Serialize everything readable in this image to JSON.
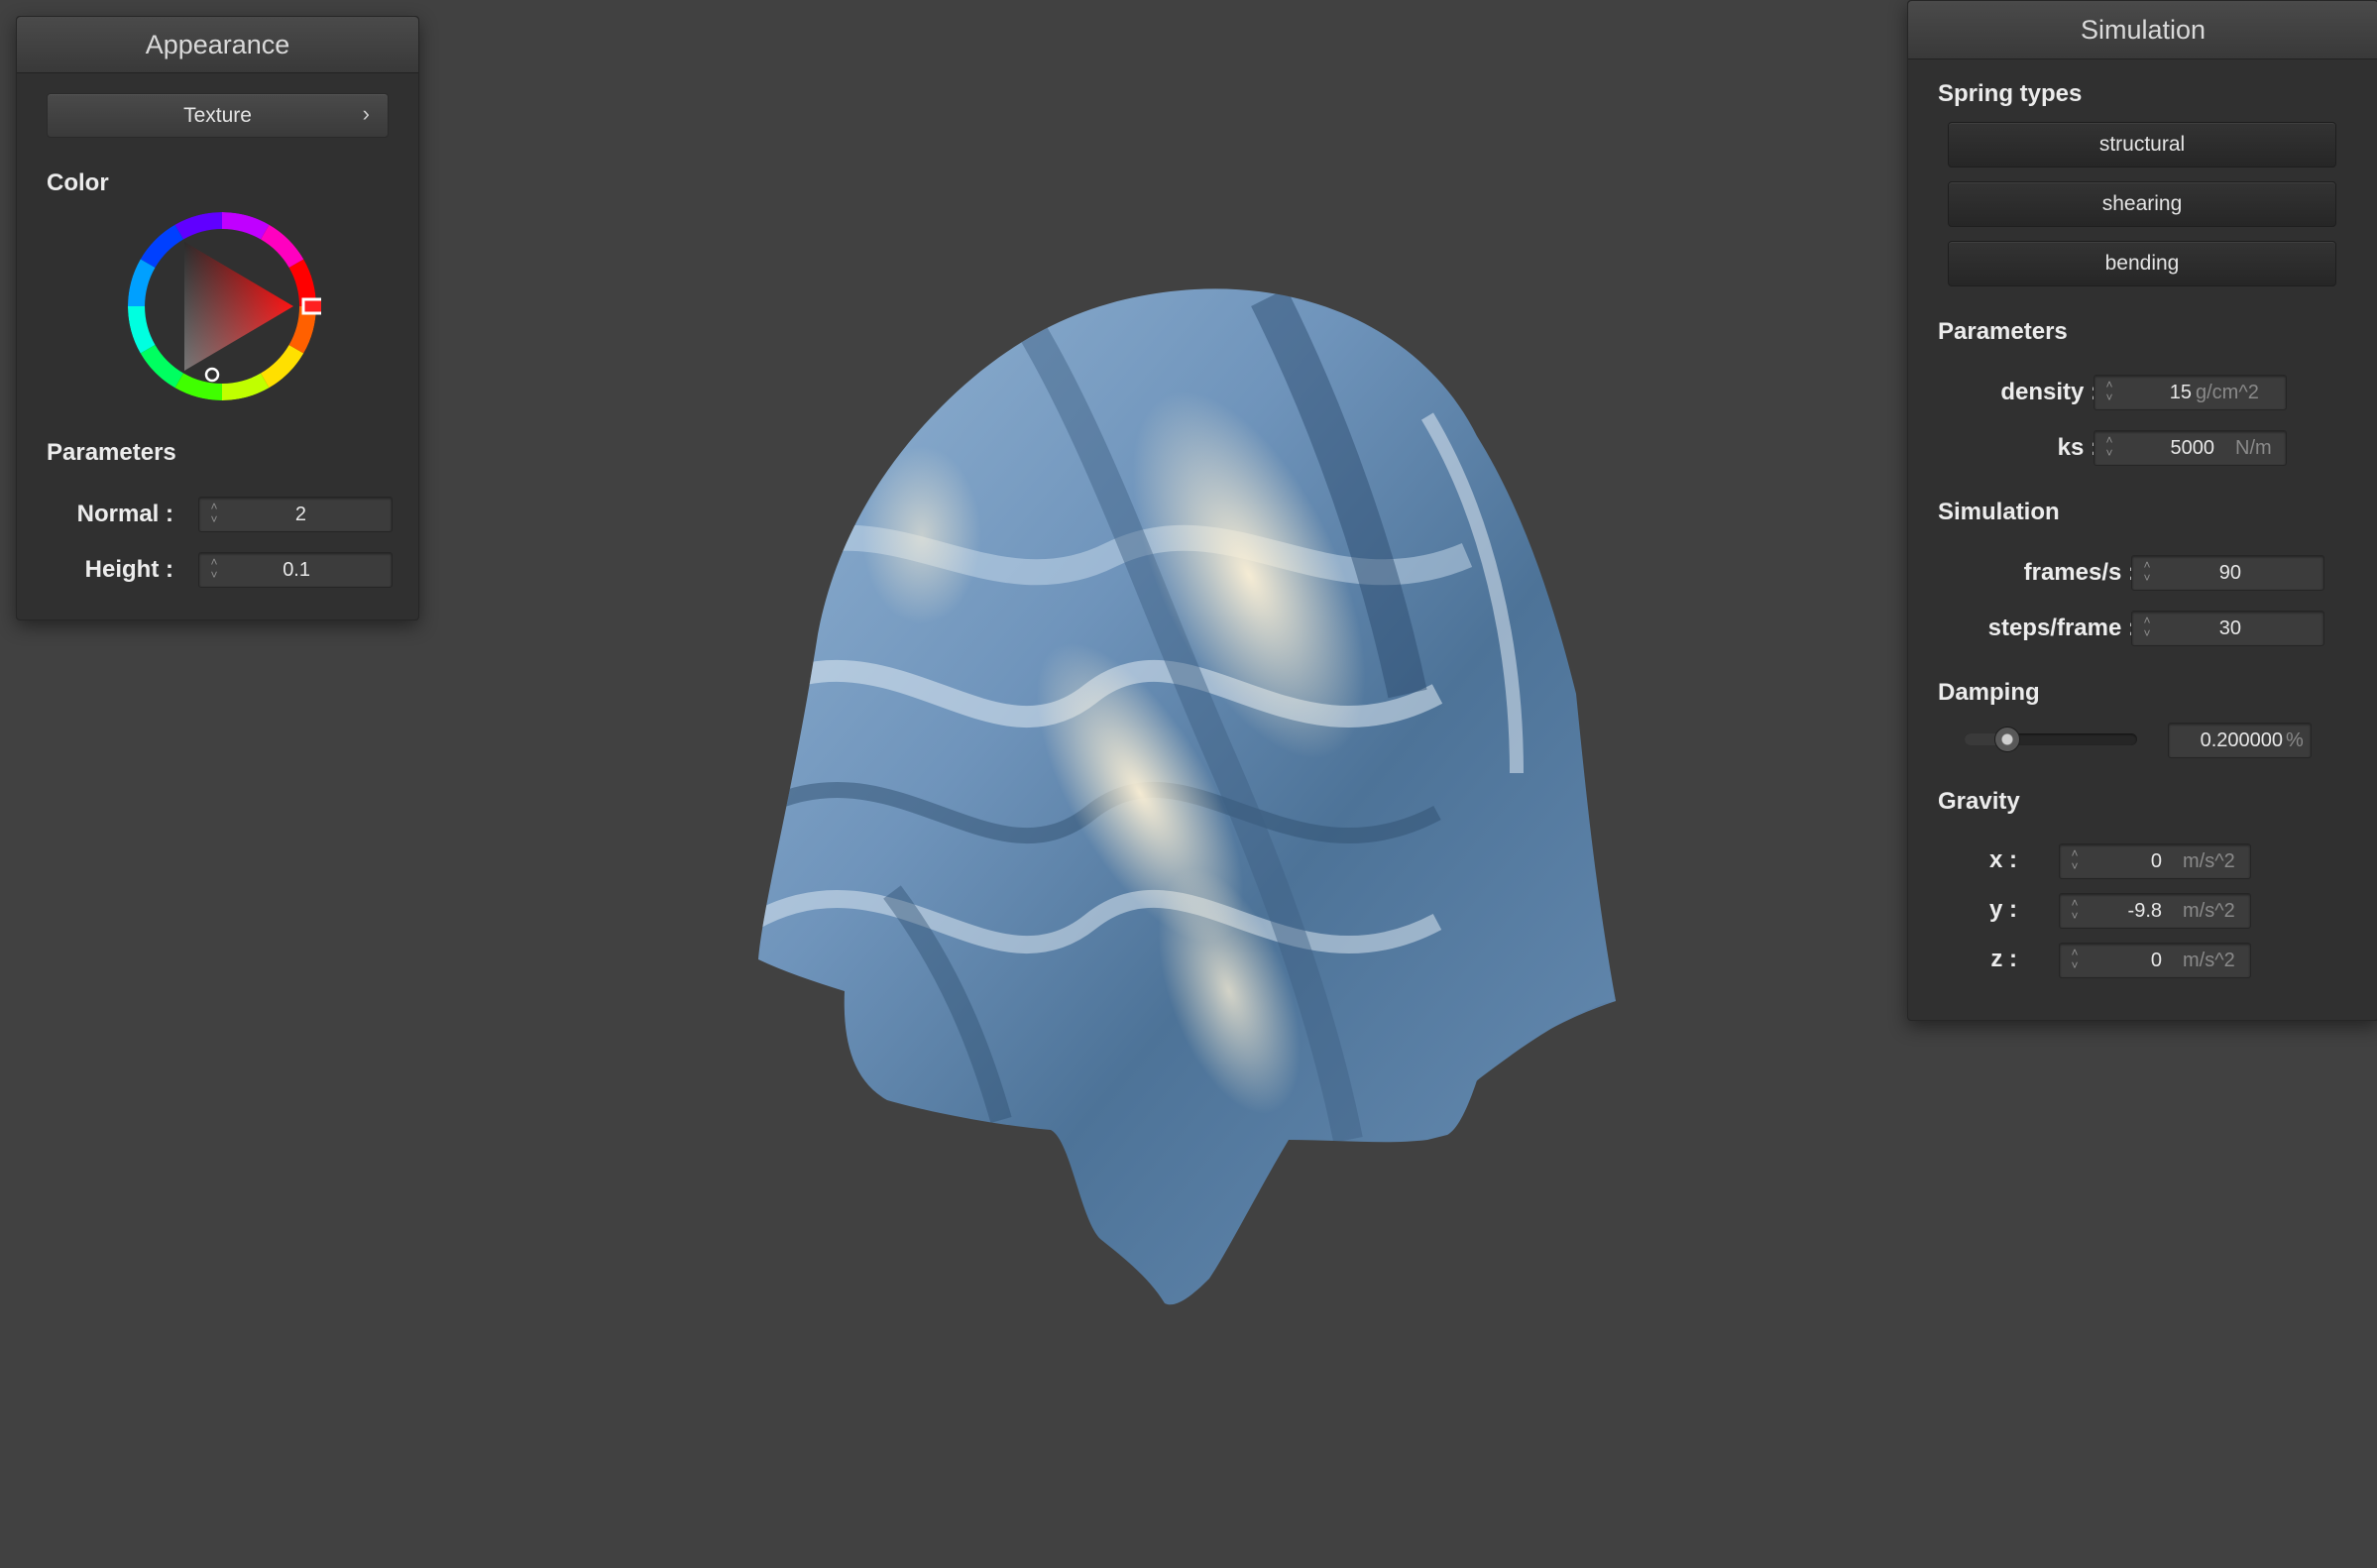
{
  "appearance": {
    "title": "Appearance",
    "texture_label": "Texture",
    "texture_chevron": "›",
    "color_label": "Color",
    "selected_color": "#ff0000",
    "params_label": "Parameters",
    "normal": {
      "label": "Normal :",
      "value": "2"
    },
    "height": {
      "label": "Height :",
      "value": "0.1"
    }
  },
  "simulation": {
    "title": "Simulation",
    "spring_types_label": "Spring types",
    "spring_buttons": [
      "structural",
      "shearing",
      "bending"
    ],
    "params_label": "Parameters",
    "density": {
      "label": "density :",
      "value": "15",
      "unit": "g/cm^2"
    },
    "ks": {
      "label": "ks :",
      "value": "5000",
      "unit": "N/m"
    },
    "sim_label": "Simulation",
    "fps": {
      "label": "frames/s :",
      "value": "90"
    },
    "steps": {
      "label": "steps/frame :",
      "value": "30"
    },
    "damping_label": "Damping",
    "damping": {
      "value": "0.200000",
      "unit": "%",
      "fraction": 0.2
    },
    "gravity_label": "Gravity",
    "gx": {
      "label": "x :",
      "value": "0",
      "unit": "m/s^2"
    },
    "gy": {
      "label": "y :",
      "value": "-9.8",
      "unit": "m/s^2"
    },
    "gz": {
      "label": "z :",
      "value": "0",
      "unit": "m/s^2"
    }
  },
  "colors": {
    "background": "#414141",
    "panel": "#303030",
    "cloth_base": "#5f87b0",
    "cloth_highlight": "#f1e3c2"
  }
}
